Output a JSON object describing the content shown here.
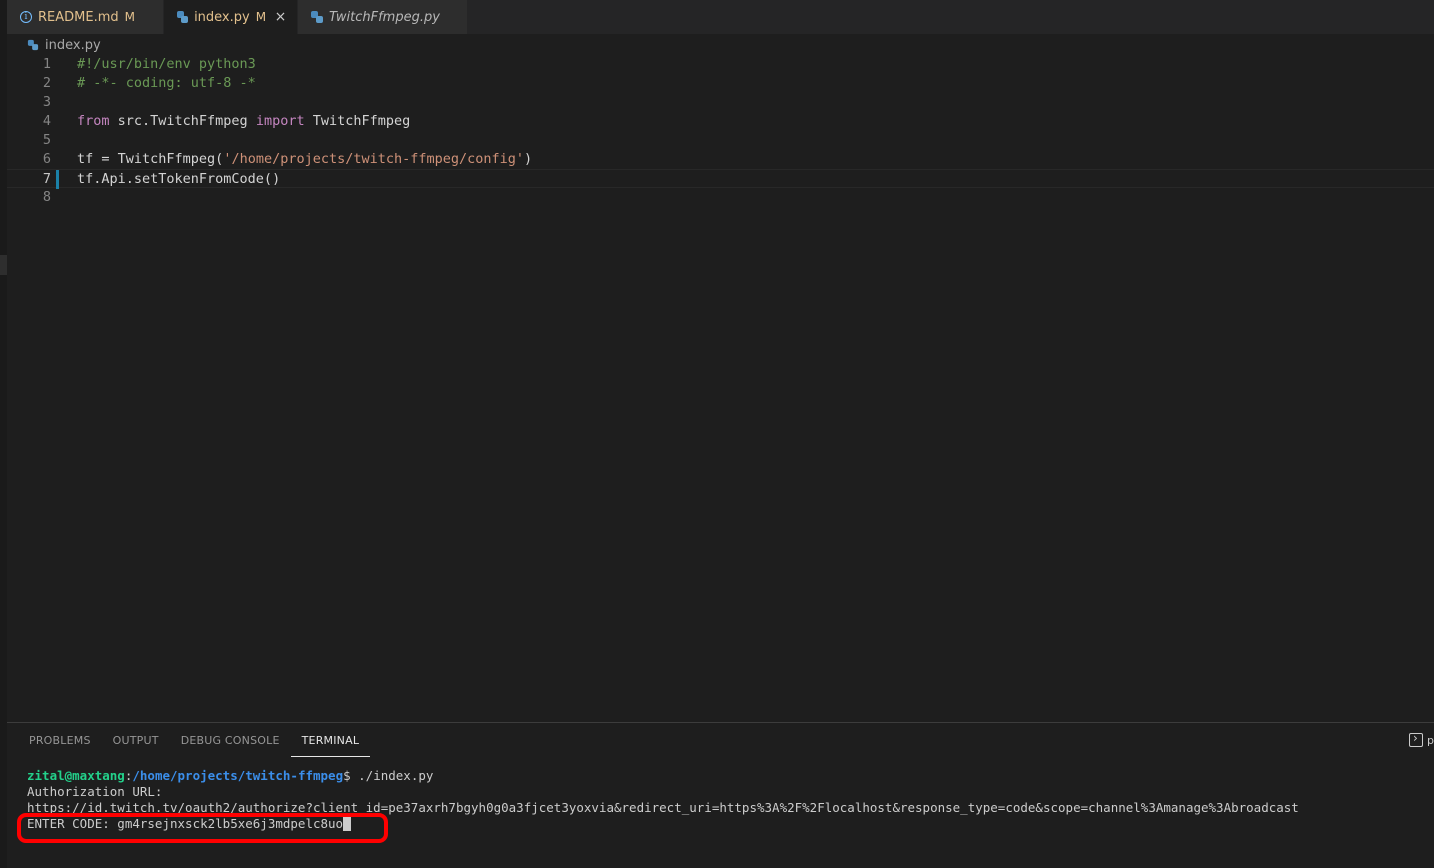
{
  "tabs": [
    {
      "label": "README.md",
      "badge": "M",
      "icon": "info-icon",
      "active": false,
      "italic": false
    },
    {
      "label": "index.py",
      "badge": "M",
      "icon": "python-file-icon",
      "active": true,
      "italic": false,
      "close": "×"
    },
    {
      "label": "TwitchFfmpeg.py",
      "badge": "",
      "icon": "python-file-icon",
      "active": false,
      "italic": true
    }
  ],
  "breadcrumb": {
    "file": "index.py"
  },
  "editor": {
    "current_line": 7,
    "lines": [
      {
        "n": "1",
        "text": "#!/usr/bin/env python3"
      },
      {
        "n": "2",
        "text": "# -*- coding: utf-8 -*"
      },
      {
        "n": "3",
        "text": ""
      },
      {
        "n": "4",
        "kw1": "from",
        "mid": " src.TwitchFfmpeg ",
        "kw2": "import",
        "rest": " TwitchFfmpeg"
      },
      {
        "n": "5",
        "text": ""
      },
      {
        "n": "6",
        "pre": "tf = TwitchFfmpeg(",
        "str": "'/home/projects/twitch-ffmpeg/config'",
        "post": ")"
      },
      {
        "n": "7",
        "text": "tf.Api.setTokenFromCode()"
      },
      {
        "n": "8",
        "text": ""
      }
    ]
  },
  "panel": {
    "tabs": [
      "PROBLEMS",
      "OUTPUT",
      "DEBUG CONSOLE",
      "TERMINAL"
    ],
    "active_tab": "TERMINAL",
    "right_label": "p"
  },
  "terminal": {
    "user_host": "zital@maxtang",
    "colon": ":",
    "path": "/home/projects/twitch-ffmpeg",
    "command": "$ ./index.py",
    "line2": "Authorization URL:",
    "line3": "https://id.twitch.tv/oauth2/authorize?client_id=pe37axrh7bgyh0g0a3fjcet3yoxvia&redirect_uri=https%3A%2F%2Flocalhost&response_type=code&scope=channel%3Amanage%3Abroadcast",
    "line4": "ENTER CODE: gm4rsejnxsck2lb5xe6j3mdpelc8uo"
  },
  "colors": {
    "highlight": "#ff0000",
    "prompt_user": "#23d18b",
    "prompt_path": "#3b8eea"
  }
}
